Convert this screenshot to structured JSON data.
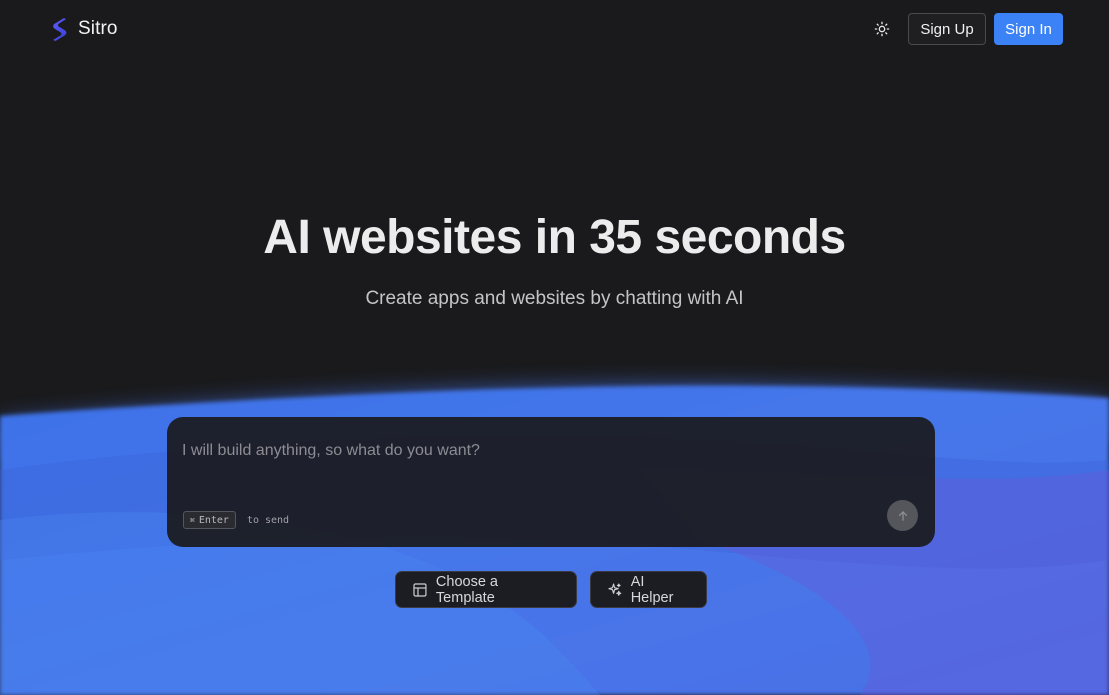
{
  "app": {
    "brand_name": "Sitro",
    "logo_icon": "sitro-s-logo-icon",
    "accent_color": "#3b82f6"
  },
  "header": {
    "theme_icon": "sun-icon",
    "signup_label": "Sign Up",
    "signin_label": "Sign In"
  },
  "hero": {
    "title": "AI websites in 35 seconds",
    "subtitle": "Create apps and websites by chatting with AI"
  },
  "prompt": {
    "placeholder": "I will build anything, so what do you want?",
    "value": "",
    "shortcut_symbol": "⌘",
    "shortcut_key": "Enter",
    "shortcut_text": "to send",
    "send_icon": "arrow-up-icon"
  },
  "actions": {
    "template_label": "Choose a Template",
    "template_icon": "layout-template-icon",
    "helper_label": "AI Helper",
    "helper_icon": "sparkles-icon"
  }
}
